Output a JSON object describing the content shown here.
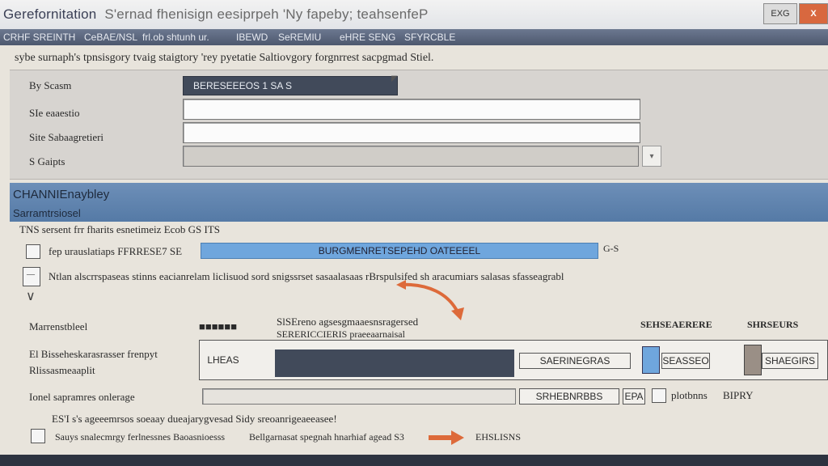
{
  "window": {
    "title": "Gerefornitation",
    "title_suffix": "S'ernad fhenisign eesiprpeh 'Ny fapeby; teahsenfeP",
    "minimize_label": "EXG",
    "close_label": "X"
  },
  "menubar": {
    "items": [
      "CRHF SREINTH",
      "CeBAE/NSL",
      "frl.ob shtunh ur.",
      "IBEWD",
      "SeREMIU",
      "eHRE SENG",
      "SFYRCBLE"
    ]
  },
  "instructions": "sybe surnaph's tpnsisgory tvaig staigtory 'rey pyetatie Saltiovgory forgnrrest sacpgmad Stiel.",
  "form": {
    "rows": [
      {
        "label": "By Scasm",
        "value": "BERESEEEOS 1 SA S"
      },
      {
        "label": "SIe eaaestio",
        "value": ""
      },
      {
        "label": "Site Sabaagretieri",
        "value": ""
      },
      {
        "label": "S  Gaipts",
        "value": ""
      }
    ]
  },
  "section": {
    "title": "CHANNIEnaybley",
    "subtitle": "Sarramtrsiosel"
  },
  "options": {
    "heading": "TNS sersent frr fharits esnetimeiz  Ecob  GS ITS",
    "row1_label": "fep urauslatiaps FFRRESE7 SE",
    "row1_bar": "BURGMENRETSEPEHD OATEEEEL",
    "row1_after": "G-S",
    "row2_text": "Ntlan alscrrspaseas stinns eacianrelam liclisuod sord snigssrset sasaalasaas rBrspulsifed sh aracumiars salasas sfasseagrabl",
    "row2_check": "—",
    "arrow_mark": "∨"
  },
  "table": {
    "col1_header": "Marrenstbleel",
    "col2_header": "SlSEreno agsesgmaaesnsragersed",
    "col2_sub": "SERERICCIERIS praeeaarnaisal",
    "col3_header": "SEHSEAERERE",
    "col4_header": "SHRSEURS",
    "row_label": "El Bisseheskarasrasser frenpyt",
    "row_label2": "Rlissasmeaaplit",
    "cell_left": "LHEAS",
    "cell_mid": "SAERINEGRAS",
    "cell_right": "SEASSEO",
    "cell_far": "SHAEGIRS"
  },
  "bottom": {
    "row_label": "Ionel sapramres onlerage",
    "field1": "SRHEBNRBBS",
    "field1_small": "EPA",
    "plus_label": "plotbnns",
    "plus_value": "BIPRY",
    "note": "ES'I s's ageeemrsos soeaay dueajarygvesad Sidy sreoanrigeaeeasee!",
    "check_label": "Sauys snalecmrgy ferlnessnes Baoasnioesss",
    "link_text": "Bellgarnasat spegnah hnarhiaf agead S3",
    "link_target": "EHSLISNS"
  },
  "colors": {
    "accent_blue": "#6fa6dd",
    "section_blue": "#5f84b0",
    "dark_field": "#414a5a",
    "arrow_orange": "#dd6a3a",
    "close_red": "#d8683f"
  }
}
